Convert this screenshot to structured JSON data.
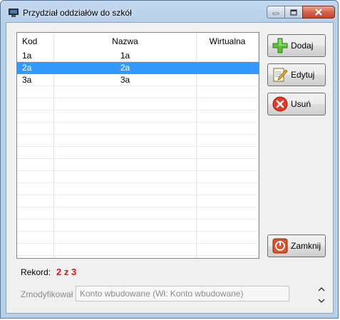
{
  "window": {
    "title": "Przydział oddziałów do szkół"
  },
  "grid": {
    "columns": [
      "Kod",
      "Nazwa",
      "Wirtualna"
    ],
    "rows": [
      {
        "kod": "1a",
        "nazwa": "1a",
        "wirtualna": ""
      },
      {
        "kod": "2a",
        "nazwa": "2a",
        "wirtualna": "",
        "selected": true
      },
      {
        "kod": "3a",
        "nazwa": "3a",
        "wirtualna": ""
      }
    ],
    "selected_color": "#3399ff"
  },
  "buttons": {
    "add": {
      "label": "Dodaj",
      "icon": "plus-icon"
    },
    "edit": {
      "label": "Edytuj",
      "icon": "notepad-pencil-icon"
    },
    "delete": {
      "label": "Usuń",
      "icon": "red-x-icon"
    },
    "close": {
      "label": "Zamknij",
      "icon": "power-icon"
    }
  },
  "record": {
    "label": "Rekord:",
    "value": "2 z 3",
    "value_color": "#e01010"
  },
  "modified": {
    "label": "Zmodyfikował",
    "value": "Konto wbudowane (Wł: Konto wbudowane)"
  }
}
